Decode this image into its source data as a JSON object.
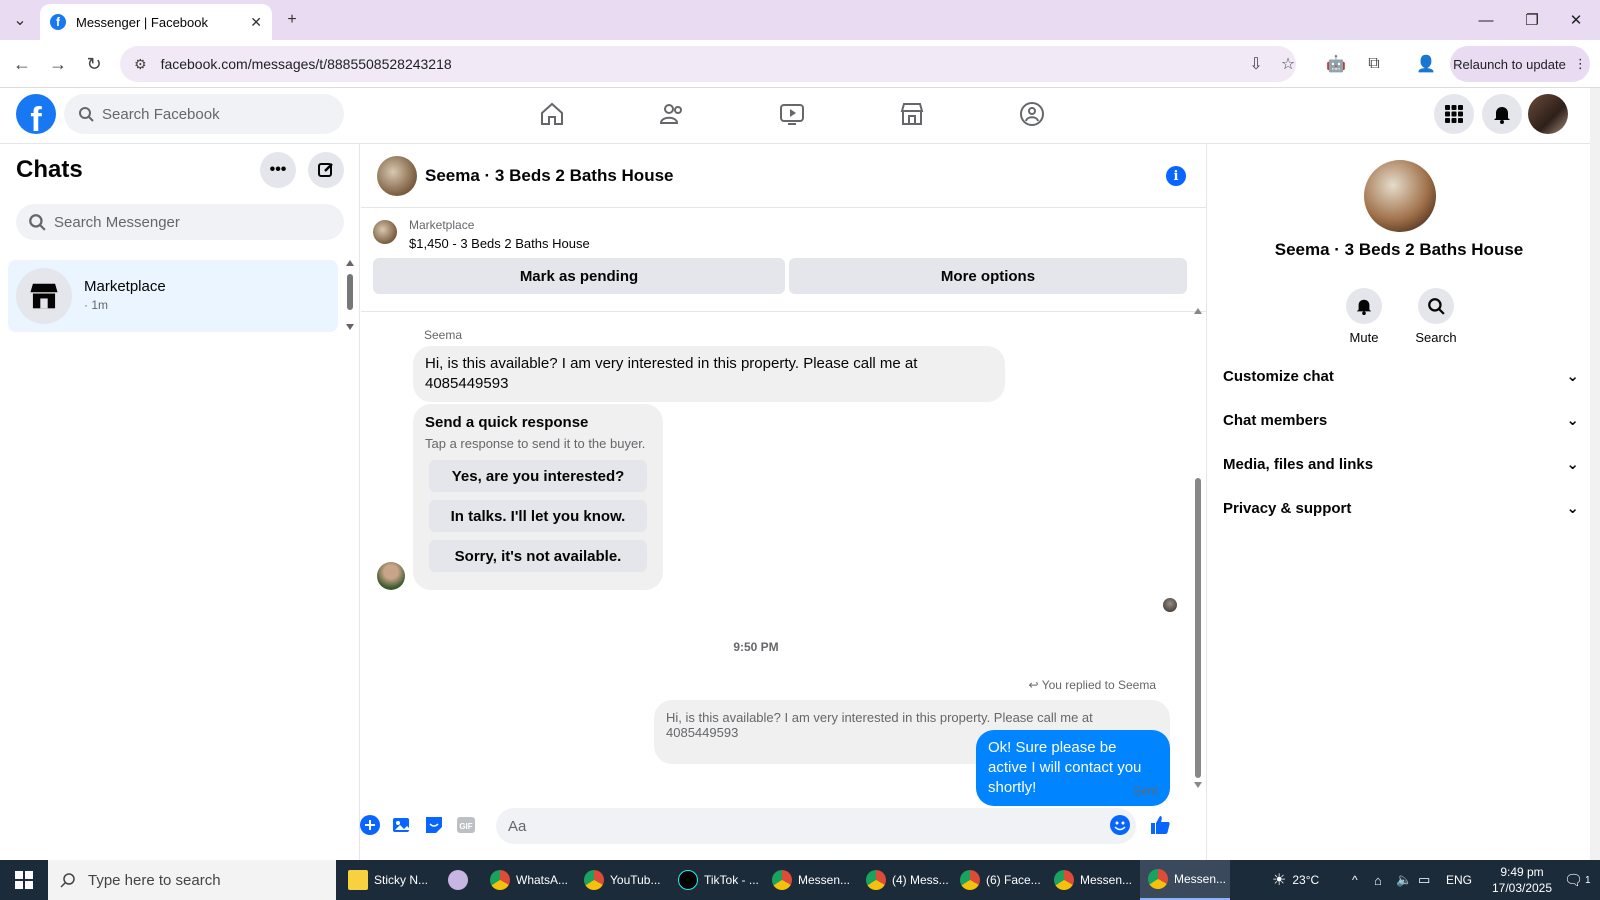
{
  "browser": {
    "tab_title": "Messenger | Facebook",
    "url": "facebook.com/messages/t/8885508528243218",
    "relaunch_label": "Relaunch to update"
  },
  "fb": {
    "search_placeholder": "Search Facebook"
  },
  "chats": {
    "title": "Chats",
    "search_placeholder": "Search Messenger",
    "items": [
      {
        "name": "Marketplace",
        "time": "· 1m"
      }
    ]
  },
  "conversation": {
    "title": "Seema · 3 Beds 2 Baths House",
    "marketplace_label": "Marketplace",
    "listing": "$1,450 - 3 Beds 2 Baths House",
    "mark_pending_label": "Mark as pending",
    "more_options_label": "More options",
    "sender_name": "Seema",
    "incoming_message": "Hi, is this available? I am very interested in this property. Please call me at 4085449593",
    "quick_response": {
      "title": "Send a quick response",
      "subtitle": "Tap a response to send it to the buyer.",
      "options": [
        "Yes, are you interested?",
        "In talks. I'll let you know.",
        "Sorry, it's not available."
      ]
    },
    "timestamp": "9:50 PM",
    "replied_to": "You replied to Seema",
    "quoted_message": "Hi, is this available? I am very interested in this property. Please call me at 4085449593",
    "outgoing_message": "Ok! Sure please be active I will contact you shortly!",
    "sent_label": "Sent",
    "composer_placeholder": "Aa"
  },
  "detail": {
    "name": "Seema · 3 Beds 2 Baths House",
    "actions": [
      {
        "label": "Mute",
        "icon": "bell-icon"
      },
      {
        "label": "Search",
        "icon": "search-icon"
      }
    ],
    "sections": [
      "Customize chat",
      "Chat members",
      "Media, files and links",
      "Privacy & support"
    ]
  },
  "taskbar": {
    "search_placeholder": "Type here to search",
    "apps": [
      {
        "label": "Sticky N...",
        "color": "#f7d23e"
      },
      {
        "label": "WhatsA...",
        "color": "#dd4b39"
      },
      {
        "label": "YouTub...",
        "color": "#dd4b39"
      },
      {
        "label": "TikTok - ...",
        "color": "#000000"
      },
      {
        "label": "Messen...",
        "color": "#dd4b39"
      },
      {
        "label": "(4) Mess...",
        "color": "#dd4b39"
      },
      {
        "label": "(6) Face...",
        "color": "#dd4b39"
      },
      {
        "label": "Messen...",
        "color": "#dd4b39"
      },
      {
        "label": "Messen...",
        "color": "#dd4b39"
      }
    ],
    "weather": "23°C",
    "language": "ENG",
    "time": "9:49 pm",
    "date": "17/03/2025",
    "notification_count": "1"
  },
  "colors": {
    "fb_blue": "#1877f2",
    "messenger_blue": "#0084ff",
    "selected_chat_bg": "#ebf5ff"
  }
}
